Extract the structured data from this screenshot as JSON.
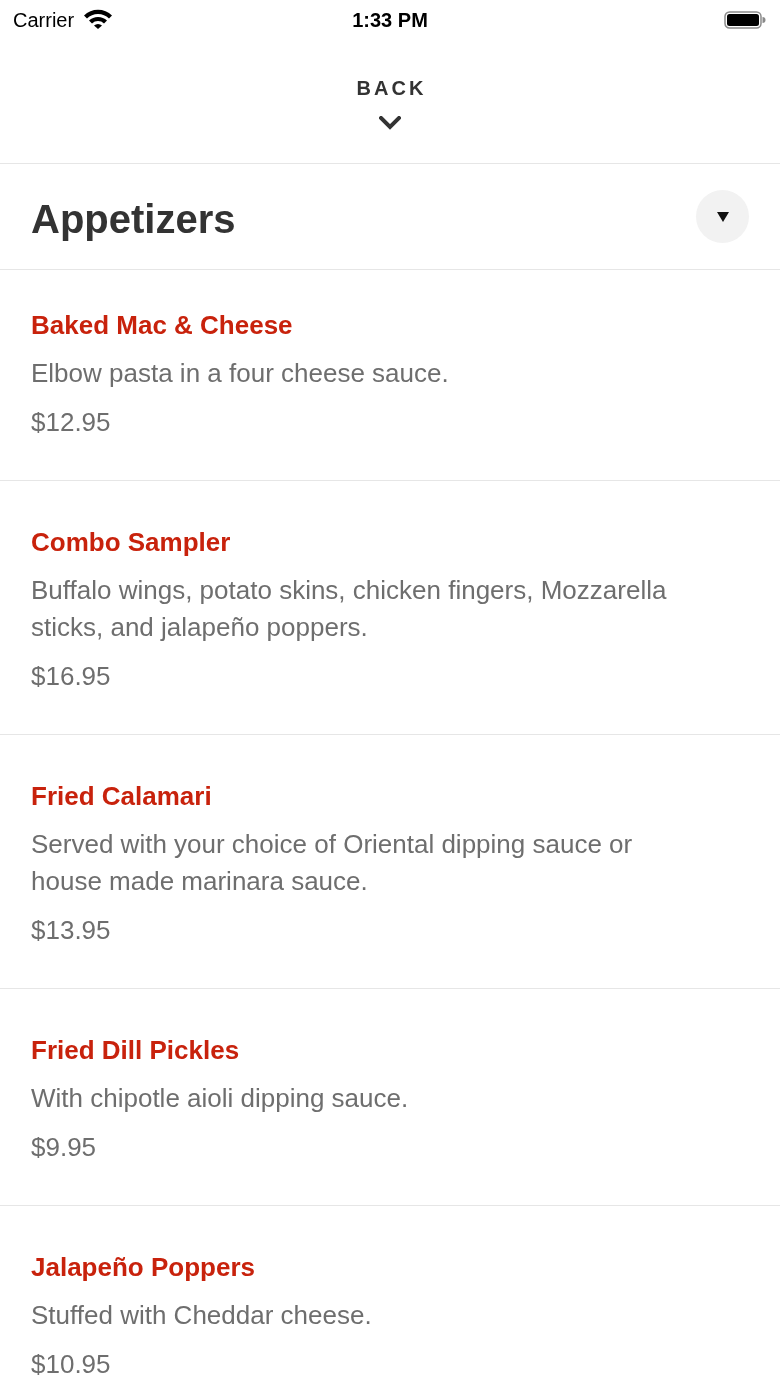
{
  "status_bar": {
    "carrier": "Carrier",
    "time": "1:33 PM"
  },
  "nav": {
    "back_label": "BACK"
  },
  "section": {
    "title": "Appetizers"
  },
  "items": [
    {
      "name": "Baked Mac & Cheese",
      "description": "Elbow pasta in a four cheese sauce.",
      "price": "$12.95"
    },
    {
      "name": "Combo Sampler",
      "description": "Buffalo wings, potato skins, chicken fingers, Mozzarella sticks, and jalapeño poppers.",
      "price": "$16.95"
    },
    {
      "name": "Fried Calamari",
      "description": "Served with your choice of Oriental dipping sauce or house made marinara sauce.",
      "price": "$13.95"
    },
    {
      "name": "Fried Dill Pickles",
      "description": "With chipotle aioli dipping sauce.",
      "price": "$9.95"
    },
    {
      "name": "Jalapeño Poppers",
      "description": "Stuffed with Cheddar cheese.",
      "price": "$10.95"
    }
  ]
}
